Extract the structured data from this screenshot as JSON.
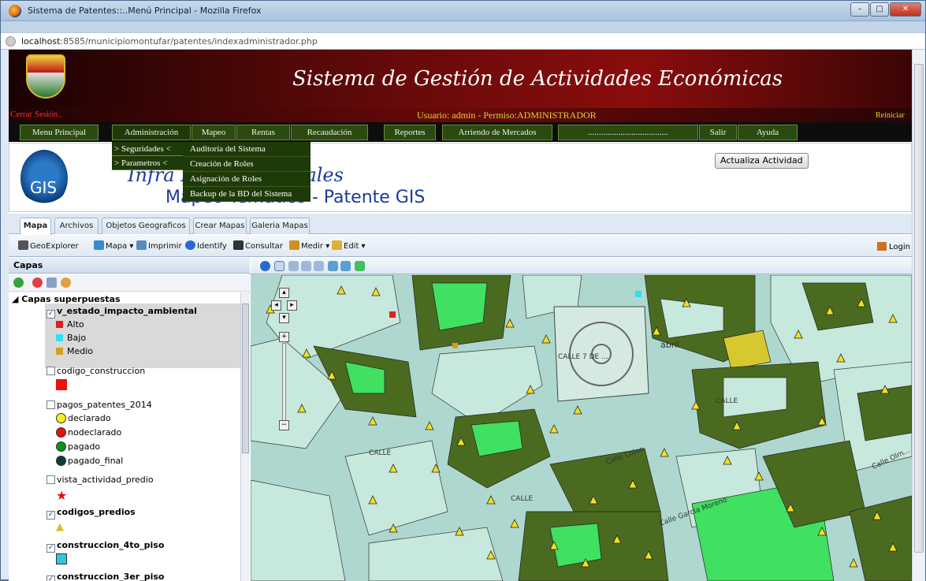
{
  "browser": {
    "window_title": "Sistema de Patentes::..Menú Principal - Mozilla Firefox",
    "url_host": "localhost",
    "url_rest": ":8585/municipiomontufar/patentes/indexadministrador.php",
    "controls": [
      "–",
      "□",
      "✕"
    ]
  },
  "header": {
    "title": "Sistema de Gestión de Actividades Económicas",
    "logout": "Cerrar Sesión..",
    "user_info": "Usuario: admin - Permiso:ADMINISTRADOR",
    "reiniciar": "Reiniciar"
  },
  "menu": [
    "Menu Principal",
    "Administración",
    "Mapeo",
    "Rentas",
    "Recaudación",
    "Reportes",
    "Arriendo de Mercados",
    ".....................................",
    "Salir",
    "Ayuda"
  ],
  "dropdown": {
    "level1": [
      "> Seguridades <",
      "> Parametros <"
    ],
    "level2": [
      "Auditoría del Sistema",
      "Creación de Roles",
      "Asignación de Roles",
      "Backup de la BD del Sistema"
    ]
  },
  "gis": {
    "logo_text": "GIS",
    "title_line1": "Infra              Datos Espaciales",
    "title_line2": "Mapeo Temático   - Patente GIS",
    "actualiza_button": "Actualiza Actividad"
  },
  "map_tabs": [
    "Mapa",
    "Archivos",
    "Objetos Geograficos",
    "Crear Mapas",
    "Galeria Mapas"
  ],
  "toolbar": {
    "geoexplorer": "GeoExplorer",
    "mapa": "Mapa ▾",
    "imprimir": "Imprimir",
    "identify": "Identify",
    "consultar": "Consultar",
    "medir": "Medir ▾",
    "edit": "Edit ▾",
    "login": "Login"
  },
  "layers": {
    "header": "Capas",
    "group": "◢ Capas superpuestas",
    "items": [
      {
        "name": "v_estado_impacto_ambiental",
        "checked": true
      },
      {
        "name": "codigo_construccion",
        "checked": false
      },
      {
        "name": "pagos_patentes_2014",
        "checked": false
      },
      {
        "name": "vista_actividad_predio",
        "checked": false
      },
      {
        "name": "codigos_predios",
        "checked": true
      },
      {
        "name": "construccion_4to_piso",
        "checked": true
      },
      {
        "name": "construccion_3er_piso",
        "checked": true
      }
    ],
    "legend_impacto": [
      {
        "label": "Alto",
        "color": "#e02020"
      },
      {
        "label": "Bajo",
        "color": "#30e0f0"
      },
      {
        "label": "Medio",
        "color": "#d0a020"
      }
    ],
    "legend_pagos": [
      {
        "label": "declarado",
        "color": "#f8f020"
      },
      {
        "label": "nodeclarado",
        "color": "#e81010"
      },
      {
        "label": "pagado",
        "color": "#109010"
      },
      {
        "label": "pagado_final",
        "color": "#0a3a3a"
      }
    ]
  },
  "map": {
    "labels": [
      "CALLE 7 DE ...",
      "CALLE",
      "Calle Colon",
      "Calle Garcia Moreno",
      "CALLE",
      "CALLE",
      "Calle Olm...",
      "abril"
    ],
    "colors": {
      "street": "#aed8cf",
      "lot": "#c7e8dc",
      "built": "#4a6a20",
      "bright": "#40e060",
      "yellow": "#d8c830",
      "marker": "#f0e020"
    }
  }
}
